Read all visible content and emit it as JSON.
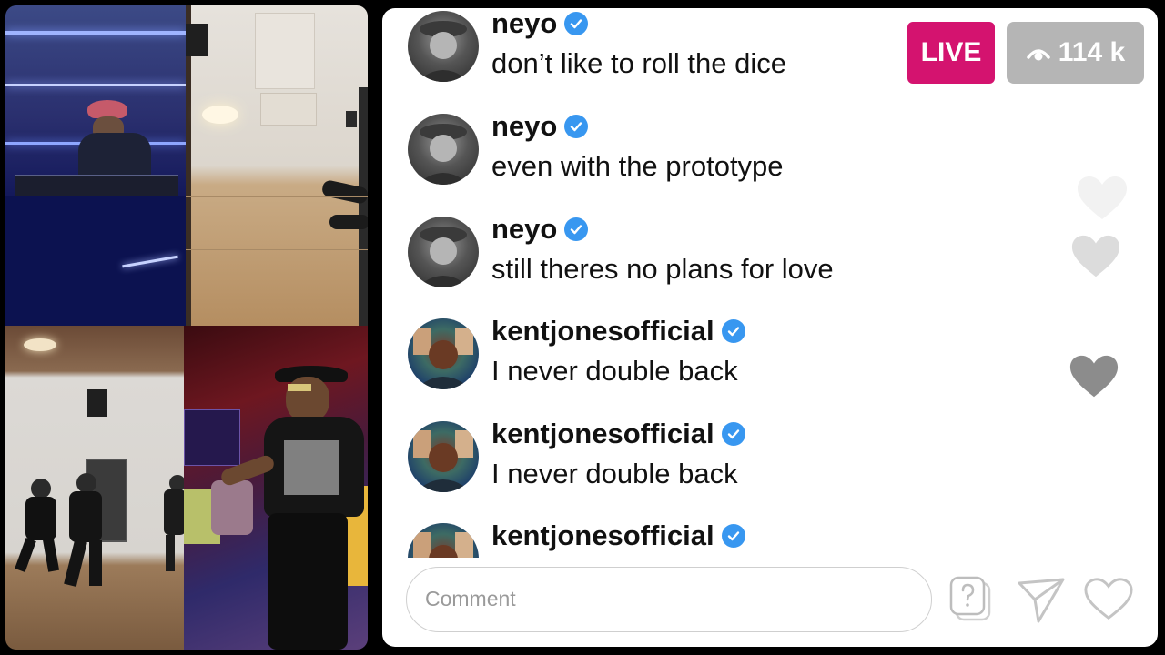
{
  "live": {
    "badge_label": "LIVE",
    "viewer_count": "114 k",
    "viewer_icon": "eye-icon"
  },
  "comments": [
    {
      "username": "neyo",
      "verified": true,
      "text": "don’t like to roll the dice"
    },
    {
      "username": "neyo",
      "verified": true,
      "text": "even with the prototype"
    },
    {
      "username": "neyo",
      "verified": true,
      "text": "still theres no plans for love"
    },
    {
      "username": "kentjonesofficial",
      "verified": true,
      "text": "I never double back"
    },
    {
      "username": "kentjonesofficial",
      "verified": true,
      "text": "I never double back"
    },
    {
      "username": "kentjonesofficial",
      "verified": true,
      "text": ""
    }
  ],
  "comment_box": {
    "placeholder": "Comment"
  },
  "actions": {
    "question_icon": "question-icon",
    "share_icon": "send-icon",
    "like_icon": "heart-icon"
  },
  "colors": {
    "live_badge": "#d4136f",
    "viewer_badge": "#b5b5b5",
    "verified": "#3897f0"
  }
}
